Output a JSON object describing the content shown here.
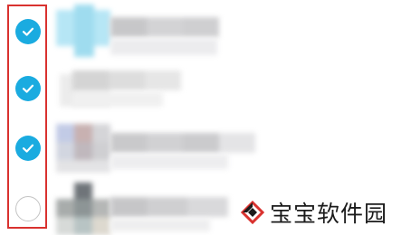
{
  "list": {
    "items": [
      {
        "selected": true,
        "check_state": "checked"
      },
      {
        "selected": true,
        "check_state": "checked"
      },
      {
        "selected": true,
        "check_state": "checked"
      },
      {
        "selected": false,
        "check_state": "unchecked"
      }
    ]
  },
  "colors": {
    "check_accent": "#1aabe0",
    "selection_outline": "#d9322f"
  },
  "watermark": {
    "text": "宝宝软件园",
    "logo_icon": "diamond-logo-icon"
  }
}
